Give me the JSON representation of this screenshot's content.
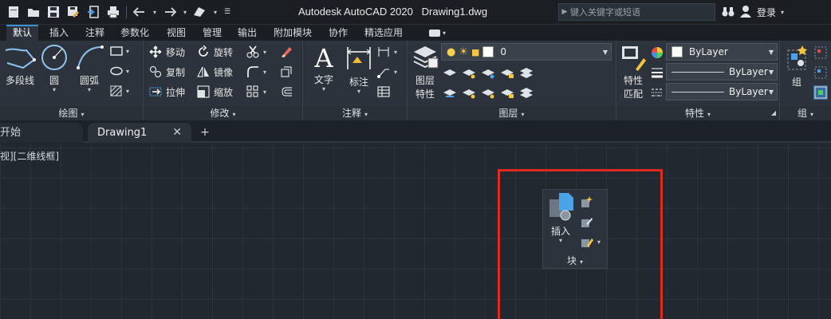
{
  "titlebar": {
    "title": "Autodesk AutoCAD 2020",
    "document": "Drawing1.dwg",
    "search_placeholder": "键入关键字或短语",
    "login": "登录",
    "quick_access": [
      "new-icon",
      "open-icon",
      "save-icon",
      "save-as-icon",
      "open-web-icon",
      "plot-icon",
      "undo-icon",
      "redo-icon",
      "share-icon",
      "customize-icon"
    ]
  },
  "ribbon_tabs": [
    "默认",
    "插入",
    "注释",
    "参数化",
    "视图",
    "管理",
    "输出",
    "附加模块",
    "协作",
    "精选应用"
  ],
  "panels": {
    "draw": {
      "title": "绘图",
      "tools": [
        "多段线",
        "圆",
        "圆弧"
      ]
    },
    "modify": {
      "title": "修改",
      "tools": [
        "移动",
        "旋转",
        "复制",
        "镜像",
        "拉伸",
        "缩放"
      ]
    },
    "annotation": {
      "title": "注释",
      "tools": [
        "文字",
        "标注"
      ]
    },
    "layers": {
      "title": "图层",
      "tool": "图层特性",
      "tool_line1": "图层",
      "tool_line2": "特性",
      "current_layer": "0"
    },
    "properties": {
      "title": "特性",
      "match_line1": "特性",
      "match_line2": "匹配",
      "color": "ByLayer",
      "linetype": "ByLayer",
      "lineweight": "ByLayer"
    },
    "groups": {
      "title": "组",
      "tool": "组"
    }
  },
  "doc_tabs": {
    "start": "开始",
    "doc": "Drawing1"
  },
  "canvas": {
    "viewport_label": "视][二维线框]"
  },
  "block_panel": {
    "tool": "插入",
    "title": "块"
  },
  "colors": {
    "accent": "#3f8ed8",
    "highlight": "#e02a20"
  }
}
